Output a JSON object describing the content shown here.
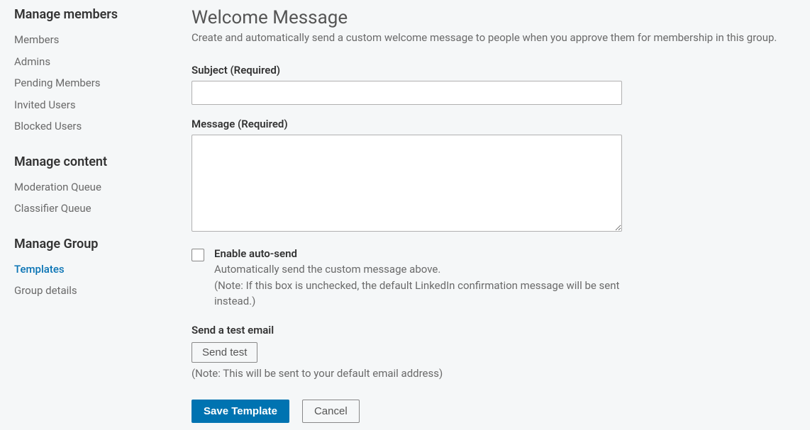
{
  "sidebar": {
    "sections": [
      {
        "heading": "Manage members",
        "items": [
          {
            "label": "Members",
            "active": false
          },
          {
            "label": "Admins",
            "active": false
          },
          {
            "label": "Pending Members",
            "active": false
          },
          {
            "label": "Invited Users",
            "active": false
          },
          {
            "label": "Blocked Users",
            "active": false
          }
        ]
      },
      {
        "heading": "Manage content",
        "items": [
          {
            "label": "Moderation Queue",
            "active": false
          },
          {
            "label": "Classifier Queue",
            "active": false
          }
        ]
      },
      {
        "heading": "Manage Group",
        "items": [
          {
            "label": "Templates",
            "active": true
          },
          {
            "label": "Group details",
            "active": false
          }
        ]
      }
    ]
  },
  "main": {
    "title": "Welcome Message",
    "subtitle": "Create and automatically send a custom welcome message to people when you approve them for membership in this group.",
    "subjectLabel": "Subject (Required)",
    "subjectValue": "",
    "messageLabel": "Message (Required)",
    "messageValue": "",
    "autosend": {
      "label": "Enable auto-send",
      "desc1": "Automatically send the custom message above.",
      "desc2": "(Note: If this box is unchecked, the default LinkedIn confirmation message will be sent instead.)"
    },
    "testEmail": {
      "heading": "Send a test email",
      "buttonLabel": "Send test",
      "note": "(Note: This will be sent to your default email address)"
    },
    "buttons": {
      "save": "Save Template",
      "cancel": "Cancel"
    }
  }
}
